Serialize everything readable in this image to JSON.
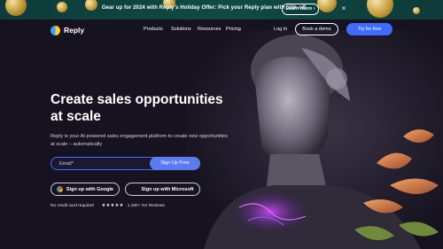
{
  "banner": {
    "text": "Gear up for 2024 with Reply's Holiday Offer: Pick your Reply plan with 50% off",
    "learn_more": "Learn more ›",
    "close": "×"
  },
  "nav": {
    "brand": "Reply",
    "links": [
      "Products",
      "Solutions",
      "Resources",
      "Pricing"
    ],
    "login": "Log In",
    "demo": "Book a demo",
    "try": "Try for free"
  },
  "hero": {
    "headline": "Create sales opportunities at scale",
    "subhead": "Reply is your AI-powered sales engagement platform to create new opportunities at scale – automatically",
    "email_placeholder": "Email*",
    "signup": "Sign Up Free",
    "google": "Sign up with Google",
    "microsoft": "Sign up with Microsoft",
    "no_card": "No credit card required",
    "stars": "★★★★★",
    "reviews": "1,160+ G2 Reviews"
  },
  "colors": {
    "accent": "#3f6bff",
    "background": "#16121f",
    "banner": "#0f4a45"
  }
}
